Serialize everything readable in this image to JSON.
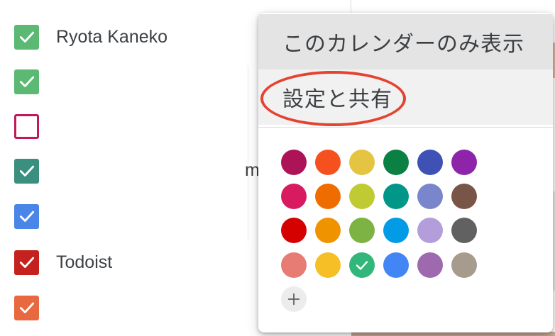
{
  "calendars": [
    {
      "label": "Ryota Kaneko",
      "color": "#5bb974",
      "checked": true
    },
    {
      "label": "",
      "color": "#5bb974",
      "checked": true
    },
    {
      "label": "",
      "color": "#c2185b",
      "checked": false
    },
    {
      "label": "",
      "color": "#3b8f7f",
      "checked": true
    },
    {
      "label": "",
      "color": "#4a86e8",
      "checked": true
    },
    {
      "label": "Todoist",
      "color": "#c5221f",
      "checked": true
    },
    {
      "label": "",
      "color": "#e8683f",
      "checked": true
    }
  ],
  "background": {
    "partial_text": "m"
  },
  "menu": {
    "display_only_label": "このカレンダーのみ表示",
    "settings_label": "設定と共有",
    "selected_color": "#5bb974",
    "colors": [
      [
        "#ad1457",
        "#f4511e",
        "#e4c441",
        "#0b8043",
        "#3f51b5",
        "#8e24aa"
      ],
      [
        "#d81b60",
        "#ef6c00",
        "#c0ca33",
        "#009688",
        "#7986cb",
        "#795548"
      ],
      [
        "#d50000",
        "#f09300",
        "#7cb342",
        "#039be5",
        "#b39ddb",
        "#616161"
      ],
      [
        "#e67c73",
        "#f6bf26",
        "#33b679",
        "#4285f4",
        "#9e69af",
        "#a79b8e"
      ]
    ],
    "add_color_icon": "plus-icon"
  },
  "annotation": {
    "color": "#e4432f",
    "target": "settings_label"
  }
}
